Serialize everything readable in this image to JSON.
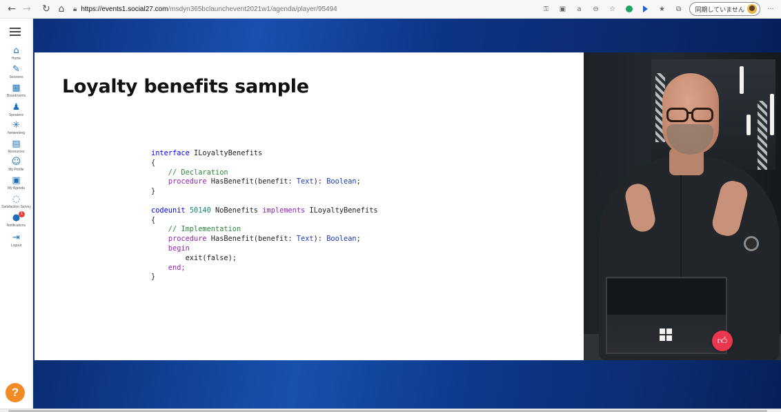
{
  "browser": {
    "url_host": "https://events1.social27.com",
    "url_path": "/msdyn365bclaunchevent2021w1/agenda/player/95494",
    "profile_label": "同期していません",
    "more": "···"
  },
  "sidebar": {
    "items": [
      {
        "label": "Home",
        "icon": "house-icon"
      },
      {
        "label": "Sessions",
        "icon": "pen-icon"
      },
      {
        "label": "Boardrooms",
        "icon": "boardroom-icon"
      },
      {
        "label": "Speakers",
        "icon": "speaker-icon"
      },
      {
        "label": "Networking",
        "icon": "networking-icon"
      },
      {
        "label": "Resources",
        "icon": "resources-icon"
      },
      {
        "label": "My Profile",
        "icon": "profile-icon"
      },
      {
        "label": "My Agenda",
        "icon": "calendar-icon"
      },
      {
        "label": "Satisfaction Survey",
        "icon": "survey-icon"
      },
      {
        "label": "Notifications",
        "icon": "bell-icon",
        "badge": "1"
      },
      {
        "label": "Logout",
        "icon": "logout-icon"
      }
    ],
    "help": "?"
  },
  "slide": {
    "title": "Loyalty benefits sample",
    "code": [
      [
        {
          "t": "interface",
          "k": "kw"
        },
        {
          "t": " ILoyaltyBenefits",
          "k": "txt"
        }
      ],
      [
        {
          "t": "{",
          "k": "txt"
        }
      ],
      [
        {
          "t": "    // Declaration",
          "k": "cm"
        }
      ],
      [
        {
          "t": "    ",
          "k": "txt"
        },
        {
          "t": "procedure",
          "k": "kw2"
        },
        {
          "t": " HasBenefit(benefit: ",
          "k": "txt"
        },
        {
          "t": "Text",
          "k": "type"
        },
        {
          "t": "): ",
          "k": "txt"
        },
        {
          "t": "Boolean",
          "k": "type"
        },
        {
          "t": ";",
          "k": "txt"
        }
      ],
      [
        {
          "t": "}",
          "k": "txt"
        }
      ],
      [
        {
          "t": "",
          "k": "txt"
        }
      ],
      [
        {
          "t": "codeunit",
          "k": "kw"
        },
        {
          "t": " ",
          "k": "txt"
        },
        {
          "t": "50140",
          "k": "num"
        },
        {
          "t": " NoBenefits ",
          "k": "txt"
        },
        {
          "t": "implements",
          "k": "kw2"
        },
        {
          "t": " ILoyaltyBenefits",
          "k": "txt"
        }
      ],
      [
        {
          "t": "{",
          "k": "txt"
        }
      ],
      [
        {
          "t": "    // Implementation",
          "k": "cm"
        }
      ],
      [
        {
          "t": "    ",
          "k": "txt"
        },
        {
          "t": "procedure",
          "k": "kw2"
        },
        {
          "t": " HasBenefit(benefit: ",
          "k": "txt"
        },
        {
          "t": "Text",
          "k": "type"
        },
        {
          "t": "): ",
          "k": "txt"
        },
        {
          "t": "Boolean",
          "k": "type"
        },
        {
          "t": ";",
          "k": "txt"
        }
      ],
      [
        {
          "t": "    begin",
          "k": "kw2"
        }
      ],
      [
        {
          "t": "        exit(false);",
          "k": "txt"
        }
      ],
      [
        {
          "t": "    end;",
          "k": "kw2"
        }
      ],
      [
        {
          "t": "}",
          "k": "txt"
        }
      ]
    ]
  },
  "like_button_icon": "thumbs-up-icon",
  "colors": {
    "accent_blue": "#1c6fb8",
    "like_red": "#e8374f",
    "help_orange": "#f28b26",
    "stage_blue": "#0f3a8a"
  }
}
